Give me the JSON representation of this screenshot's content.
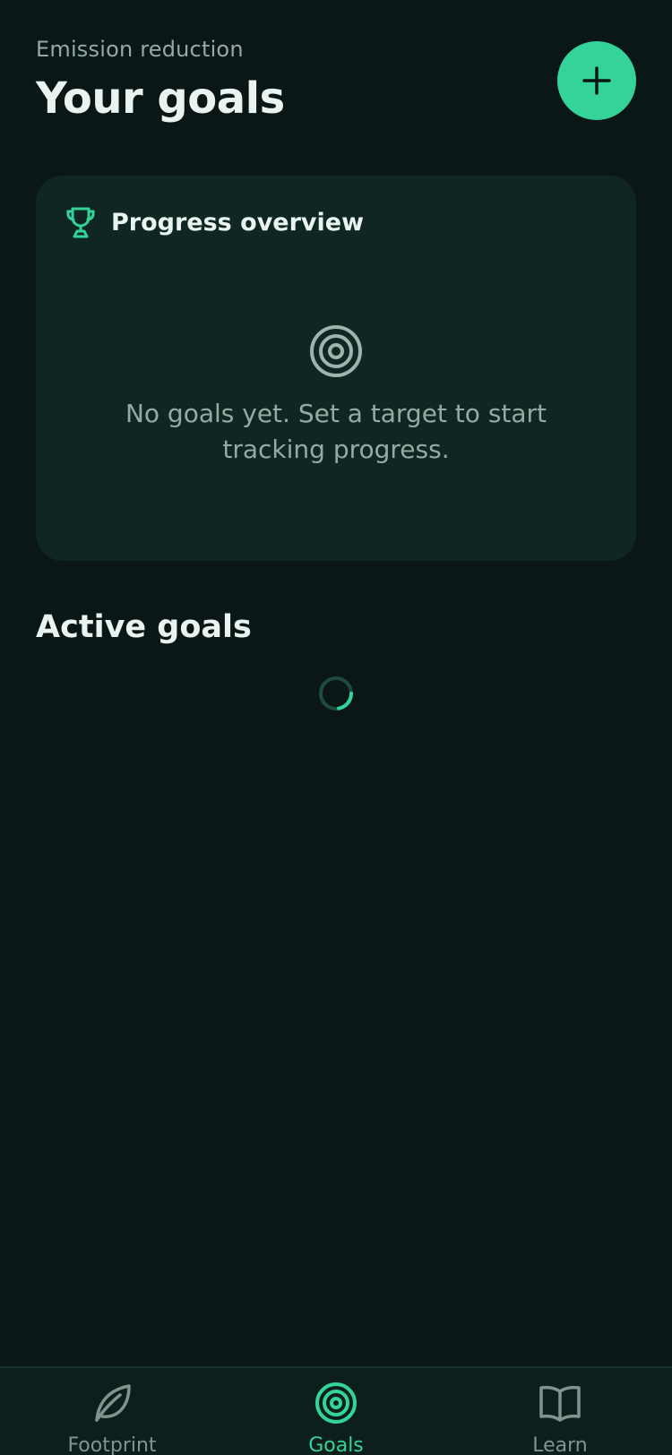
{
  "header": {
    "eyebrow": "Emission reduction",
    "title": "Your goals"
  },
  "overview": {
    "title": "Progress overview",
    "empty_text": "No goals yet. Set a target to start tracking progress."
  },
  "active_goals": {
    "title": "Active goals"
  },
  "tabs": [
    {
      "label": "Footprint",
      "icon": "leaf-icon",
      "active": false
    },
    {
      "label": "Goals",
      "icon": "target-icon",
      "active": true
    },
    {
      "label": "Learn",
      "icon": "book-icon",
      "active": false
    }
  ],
  "colors": {
    "background": "#0a1716",
    "card": "#0f2622",
    "accent": "#34d399",
    "text_primary": "#e9f3ef",
    "text_muted": "#93aba3"
  }
}
